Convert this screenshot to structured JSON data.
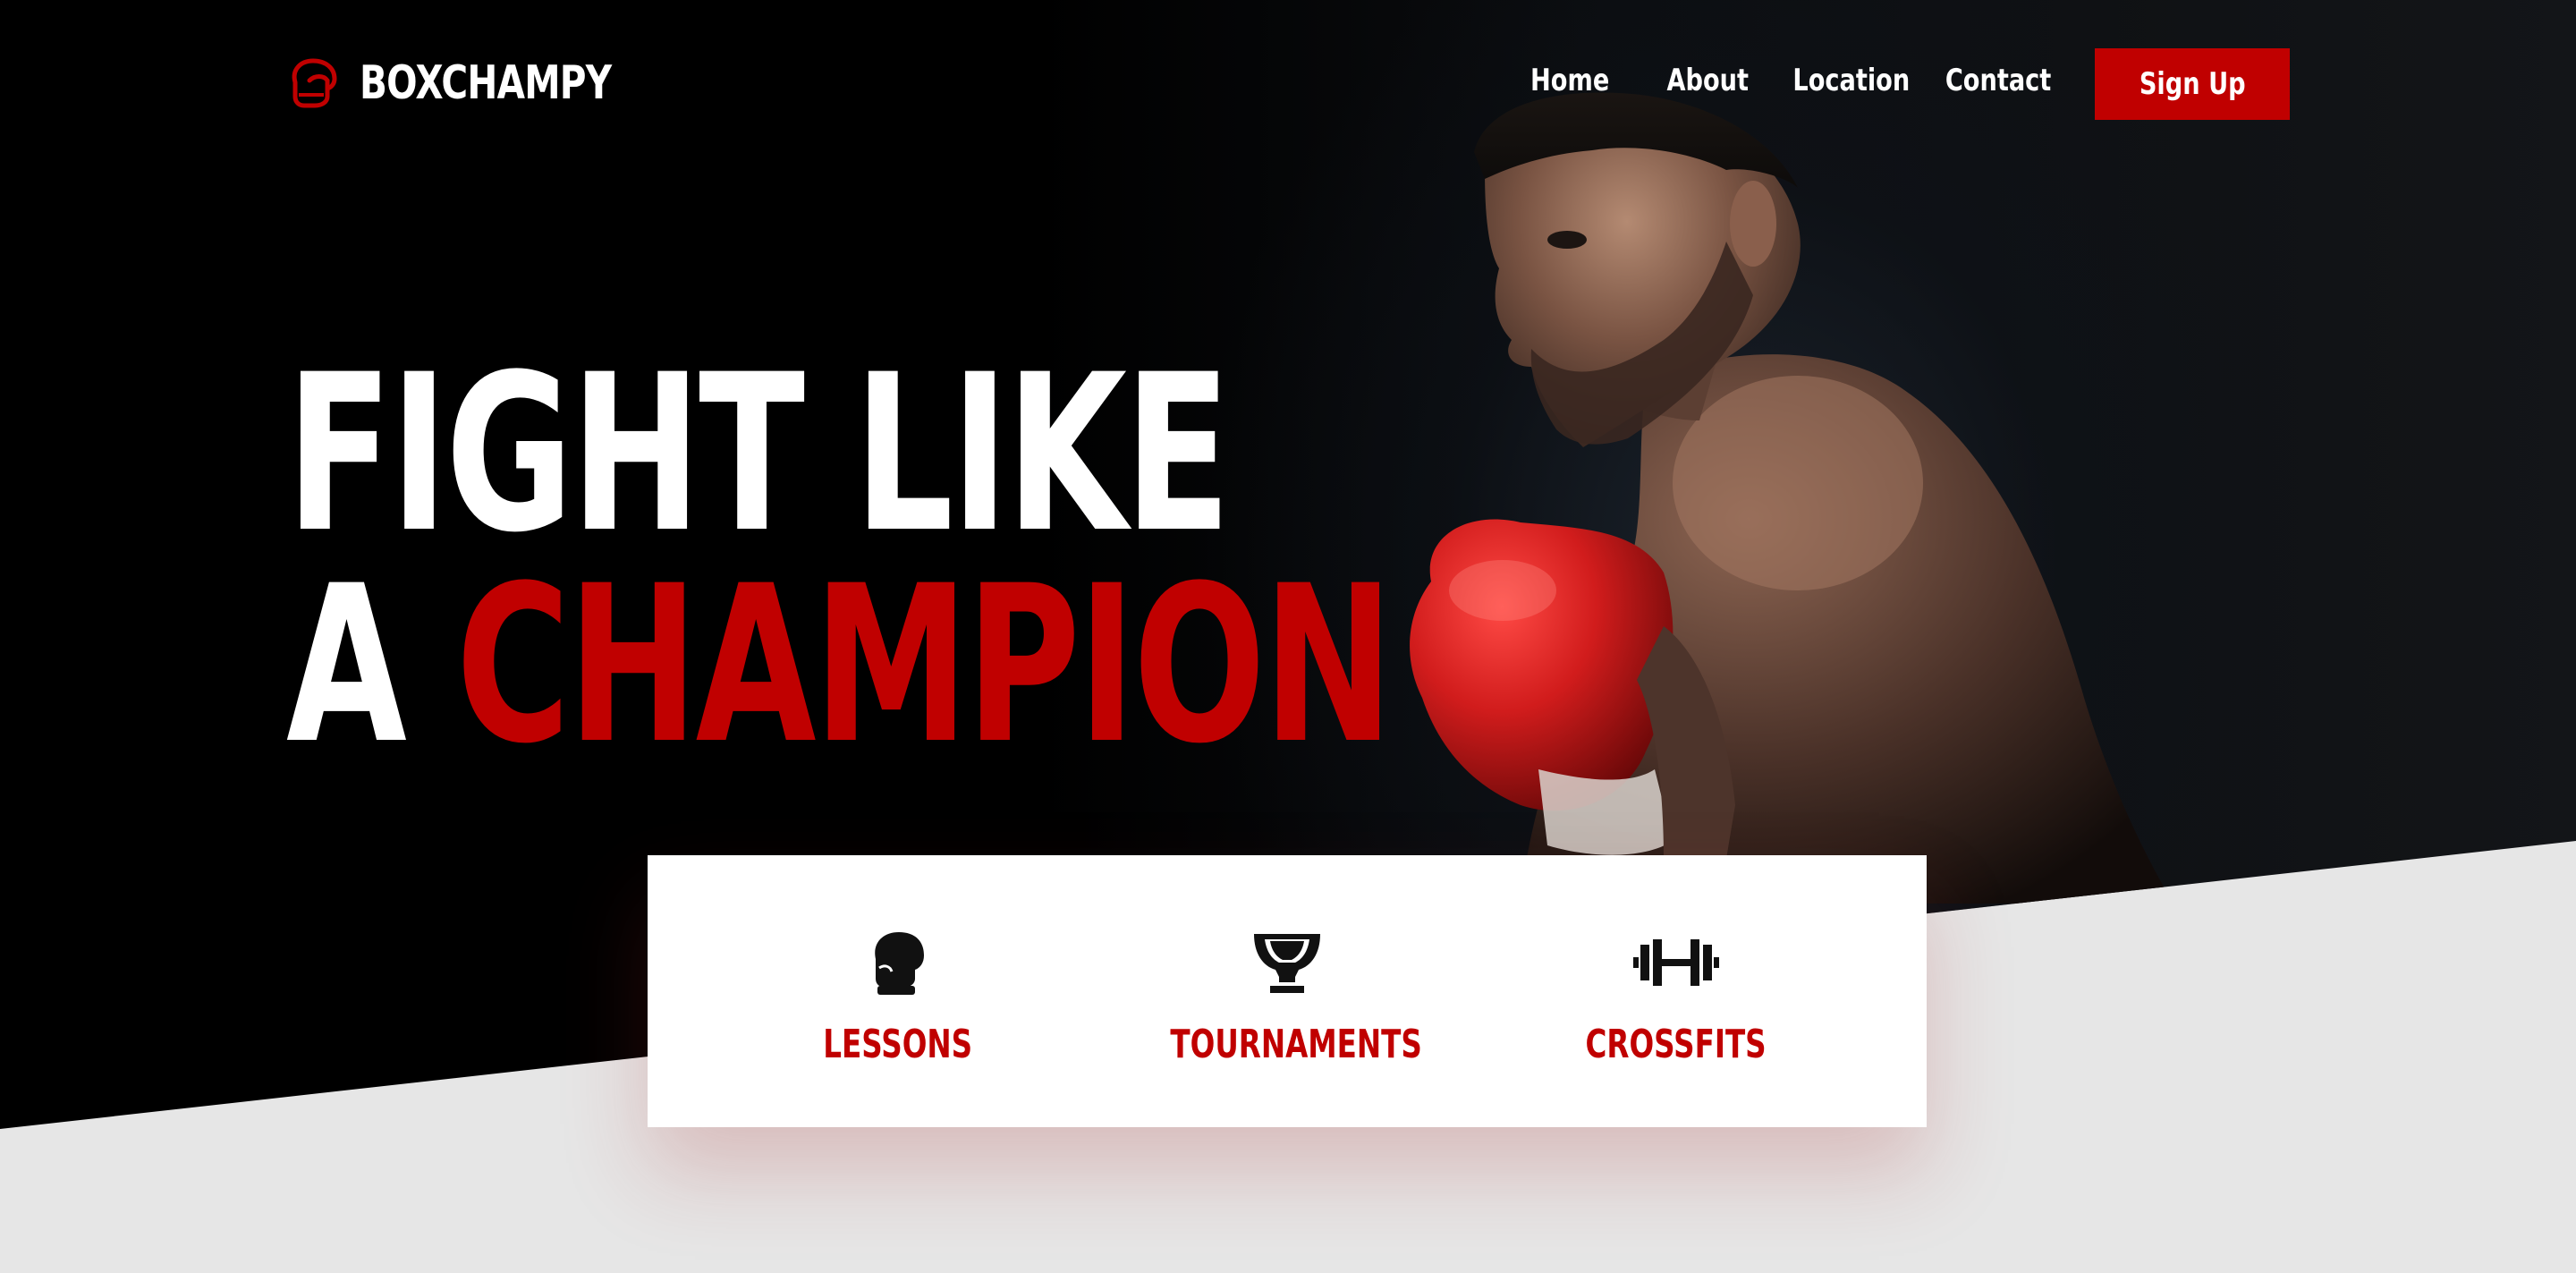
{
  "brand": {
    "name": "BOXCHAMPY",
    "logo_icon": "boxing-glove-outline-icon",
    "accent_color": "#c00000"
  },
  "nav": {
    "links": [
      "Home",
      "About",
      "Location",
      "Contact"
    ],
    "signup_label": "Sign Up"
  },
  "hero": {
    "headline_line1": "FIGHT LIKE",
    "headline_line2_prefix": "A",
    "headline_line2_highlight": "CHAMPION",
    "image_subject": "boxer with red glove"
  },
  "services": [
    {
      "label": "LESSONS",
      "icon": "boxing-glove-icon"
    },
    {
      "label": "TOURNAMENTS",
      "icon": "trophy-icon"
    },
    {
      "label": "CROSSFITS",
      "icon": "dumbbell-icon"
    }
  ],
  "colors": {
    "dark_bg": "#000000",
    "light_bg": "#e6e6e6",
    "card_bg": "#ffffff",
    "accent": "#c00000"
  }
}
